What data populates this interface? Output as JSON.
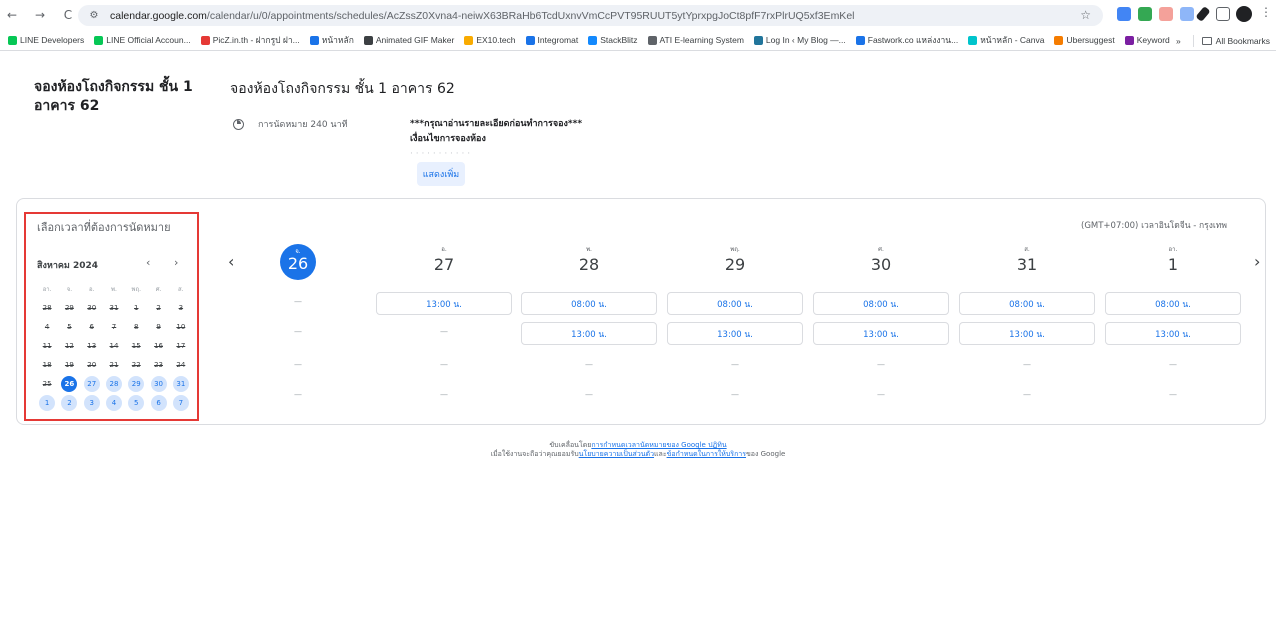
{
  "browser": {
    "url_host": "calendar.google.com",
    "url_path": "/calendar/u/0/appointments/schedules/AcZssZ0Xvna4-neiwX63BRaHb6TcdUxnvVmCcPVT95RUUT5ytYprxpgJoCt8pfF7rxPlrUQ5xf3EmKel",
    "bookmarks": [
      {
        "label": "LINE Developers",
        "color": "#06c755"
      },
      {
        "label": "LINE Official Accoun...",
        "color": "#06c755"
      },
      {
        "label": "PicZ.in.th - ฝากรูป ฝา...",
        "color": "#e53935"
      },
      {
        "label": "หน้าหลัก",
        "color": "#1a73e8"
      },
      {
        "label": "Animated GIF Maker",
        "color": "#3c4043"
      },
      {
        "label": "EX10.tech",
        "color": "#f9ab00"
      },
      {
        "label": "Integromat",
        "color": "#1a73e8"
      },
      {
        "label": "StackBlitz",
        "color": "#1389fd"
      },
      {
        "label": "ATI E-learning System",
        "color": "#5f6368"
      },
      {
        "label": "Log In ‹ My Blog —...",
        "color": "#21759b"
      },
      {
        "label": "Fastwork.co แหล่งงาน...",
        "color": "#1a73e8"
      },
      {
        "label": "หน้าหลัก - Canva",
        "color": "#00c4cc"
      },
      {
        "label": "Ubersuggest",
        "color": "#f57c00"
      },
      {
        "label": "Keyword Tool",
        "color": "#7b1fa2"
      }
    ],
    "bookmarks_overflow": "»",
    "all_bookmarks": "All Bookmarks"
  },
  "page": {
    "sidebar_title": "จองห้องโถงกิจกรรม ชั้น 1 อาคาร 62",
    "title": "จองห้องโถงกิจกรรม ชั้น 1 อาคาร 62",
    "duration": "การนัดหมาย 240 นาที",
    "description_line1": "***กรุณาอ่านรายละเอียดก่อนทำการจอง***",
    "description_line2": "เงื่อนไขการจองห้อง",
    "description_faded": "· · · · · · · · · · ·",
    "show_more": "แสดงเพิ่ม"
  },
  "booking": {
    "pick_title": "เลือกเวลาที่ต้องการนัดหมาย",
    "timezone": "(GMT+07:00) เวลาอินโดจีน - กรุงเทพ",
    "mini_calendar": {
      "month_label": "สิงหาคม 2024",
      "weekday_headers": [
        "อา.",
        "จ.",
        "อ.",
        "พ.",
        "พฤ.",
        "ศ.",
        "ส."
      ],
      "weeks": [
        [
          {
            "d": "28",
            "s": "past"
          },
          {
            "d": "29",
            "s": "past"
          },
          {
            "d": "30",
            "s": "past"
          },
          {
            "d": "31",
            "s": "past"
          },
          {
            "d": "1",
            "s": "past"
          },
          {
            "d": "2",
            "s": "past"
          },
          {
            "d": "3",
            "s": "past"
          }
        ],
        [
          {
            "d": "4",
            "s": "past"
          },
          {
            "d": "5",
            "s": "past"
          },
          {
            "d": "6",
            "s": "past"
          },
          {
            "d": "7",
            "s": "past"
          },
          {
            "d": "8",
            "s": "past"
          },
          {
            "d": "9",
            "s": "past"
          },
          {
            "d": "10",
            "s": "past"
          }
        ],
        [
          {
            "d": "11",
            "s": "past"
          },
          {
            "d": "12",
            "s": "past"
          },
          {
            "d": "13",
            "s": "past"
          },
          {
            "d": "14",
            "s": "past"
          },
          {
            "d": "15",
            "s": "past"
          },
          {
            "d": "16",
            "s": "past"
          },
          {
            "d": "17",
            "s": "past"
          }
        ],
        [
          {
            "d": "18",
            "s": "past"
          },
          {
            "d": "19",
            "s": "past"
          },
          {
            "d": "20",
            "s": "past"
          },
          {
            "d": "21",
            "s": "past"
          },
          {
            "d": "22",
            "s": "past"
          },
          {
            "d": "23",
            "s": "past"
          },
          {
            "d": "24",
            "s": "past"
          }
        ],
        [
          {
            "d": "25",
            "s": "past"
          },
          {
            "d": "26",
            "s": "selected"
          },
          {
            "d": "27",
            "s": "avail"
          },
          {
            "d": "28",
            "s": "avail"
          },
          {
            "d": "29",
            "s": "avail"
          },
          {
            "d": "30",
            "s": "avail"
          },
          {
            "d": "31",
            "s": "avail"
          }
        ],
        [
          {
            "d": "1",
            "s": "avail"
          },
          {
            "d": "2",
            "s": "avail"
          },
          {
            "d": "3",
            "s": "avail"
          },
          {
            "d": "4",
            "s": "avail"
          },
          {
            "d": "5",
            "s": "avail"
          },
          {
            "d": "6",
            "s": "avail"
          },
          {
            "d": "7",
            "s": "avail"
          }
        ]
      ]
    },
    "days": [
      {
        "dow": "จ.",
        "num": "26",
        "today": true,
        "slots": [
          "—",
          "—",
          "—",
          "—"
        ]
      },
      {
        "dow": "อ.",
        "num": "27",
        "today": false,
        "slots": [
          "13:00 น.",
          "—",
          "—",
          "—"
        ]
      },
      {
        "dow": "พ.",
        "num": "28",
        "today": false,
        "slots": [
          "08:00 น.",
          "13:00 น.",
          "—",
          "—"
        ]
      },
      {
        "dow": "พฤ.",
        "num": "29",
        "today": false,
        "slots": [
          "08:00 น.",
          "13:00 น.",
          "—",
          "—"
        ]
      },
      {
        "dow": "ศ.",
        "num": "30",
        "today": false,
        "slots": [
          "08:00 น.",
          "13:00 น.",
          "—",
          "—"
        ]
      },
      {
        "dow": "ส.",
        "num": "31",
        "today": false,
        "slots": [
          "08:00 น.",
          "13:00 น.",
          "—",
          "—"
        ]
      },
      {
        "dow": "อา.",
        "num": "1",
        "today": false,
        "slots": [
          "08:00 น.",
          "13:00 น.",
          "—",
          "—"
        ]
      }
    ]
  },
  "footer": {
    "line1_prefix": "ขับเคลื่อนโดย",
    "line1_link": "การกำหนดเวลานัดหมายของ Google ปฏิทิน",
    "line2_prefix": "เมื่อใช้งานจะถือว่าคุณยอมรับ",
    "line2_link1": "นโยบายความเป็นส่วนตัว",
    "line2_mid": "และ",
    "line2_link2": "ข้อกำหนดในการให้บริการ",
    "line2_suffix": "ของ Google"
  },
  "colors": {
    "accent": "#1a73e8",
    "accent_light": "#d2e3fc",
    "highlight": "#e53935"
  }
}
